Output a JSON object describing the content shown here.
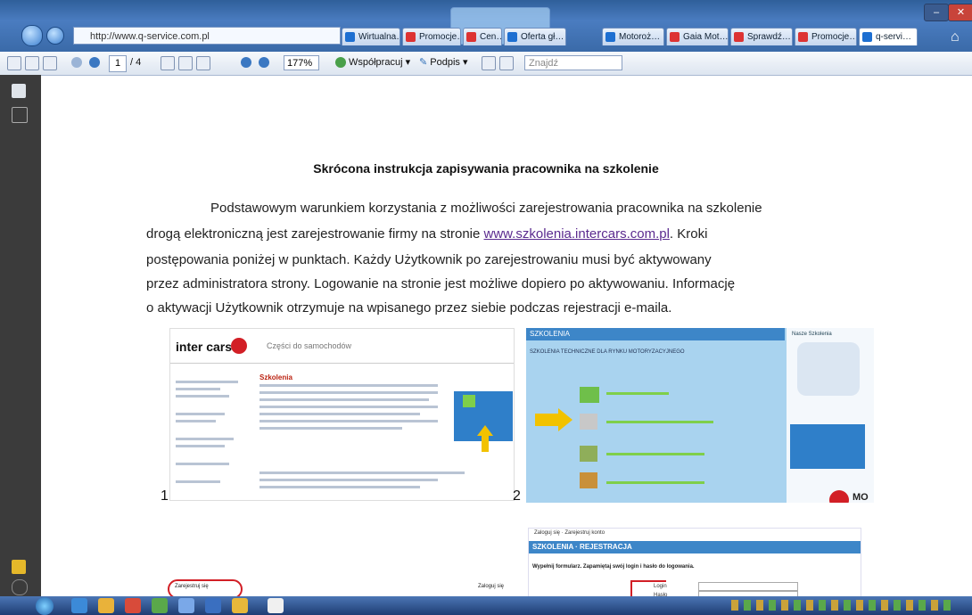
{
  "browser": {
    "address": "http://www.q-service.com.pl",
    "tabs": [
      "Wirtualna…",
      "Promocje…",
      "Cen…",
      "Oferta gł…",
      "Motoroż…",
      "Gaia Mot…",
      "Sprawdź…",
      "Promocje…",
      "q-servi…"
    ],
    "active_tab": "q-servi…"
  },
  "pdf_toolbar": {
    "page_current": "1",
    "page_total": "/ 4",
    "zoom": "177%",
    "collaborate": "Współpracuj ▾",
    "sign": "Podpis ▾",
    "search_placeholder": "Znajdź"
  },
  "document": {
    "title": "Skrócona instrukcja zapisywania pracownika na szkolenie",
    "line1": "Podstawowym warunkiem korzystania z możliwości zarejestrowania pracownika na szkolenie",
    "line2_a": "drogą elektroniczną jest zarejestrowanie firmy na stronie ",
    "line2_link": "www.szkolenia.intercars.com.pl",
    "line2_b": ". Kroki",
    "line3": "postępowania poniżej w punktach. Każdy Użytkownik po zarejestrowaniu musi być aktywowany",
    "line4": "przez administratora strony. Logowanie na stronie jest możliwe dopiero po aktywowaniu. Informację",
    "line5": "o aktywacji Użytkownik otrzymuje na wpisanego przez siebie podczas rejestracji e-maila.",
    "step1": "1",
    "step2": "2"
  },
  "screenshot1": {
    "logo": "inter cars",
    "tagline": "Części do samochodów",
    "section": "Szkolenia",
    "tab": "Zarejestruj się",
    "link": "Zaloguj się"
  },
  "screenshot2": {
    "header": "SZKOLENIA",
    "subheader": "SZKOLENIA TECHNICZNE DLA RYNKU MOTORYZACYJNEGO",
    "poland": "Nasze Szkolenia",
    "side": "MO"
  },
  "screenshot3": {
    "menu": "Zaloguj się · Zarejestruj konto",
    "header": "SZKOLENIA · REJESTRACJA",
    "instruction": "Wypełnij formularz. Zapamiętaj swój login i hasło do logowania.",
    "field1": "Login",
    "field2": "Hasło"
  }
}
